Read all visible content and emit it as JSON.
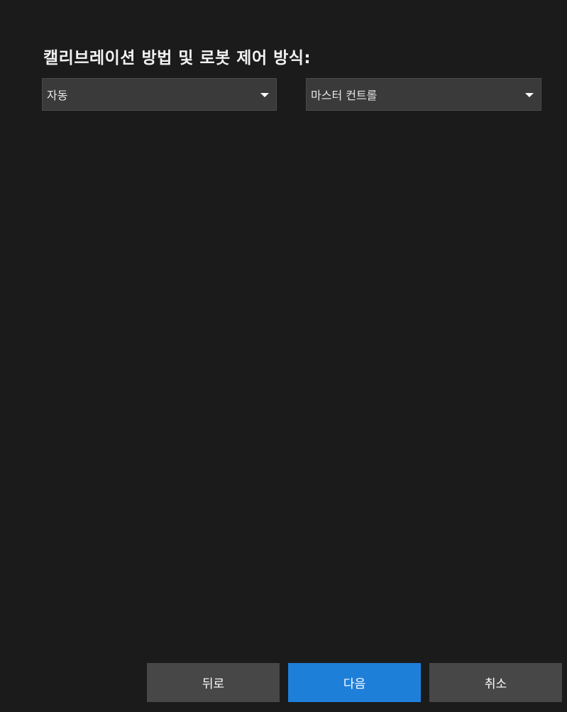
{
  "heading": "캘리브레이션 방법 및 로봇 제어 방식:",
  "calibration_method": {
    "value": "자동"
  },
  "robot_control": {
    "value": "마스터 컨트롤"
  },
  "footer": {
    "back_label": "뒤로",
    "next_label": "다음",
    "cancel_label": "취소"
  },
  "colors": {
    "background": "#1b1b1b",
    "dropdown": "#3a3a3a",
    "primary_button": "#1e7fd9",
    "secondary_button": "#474747"
  }
}
